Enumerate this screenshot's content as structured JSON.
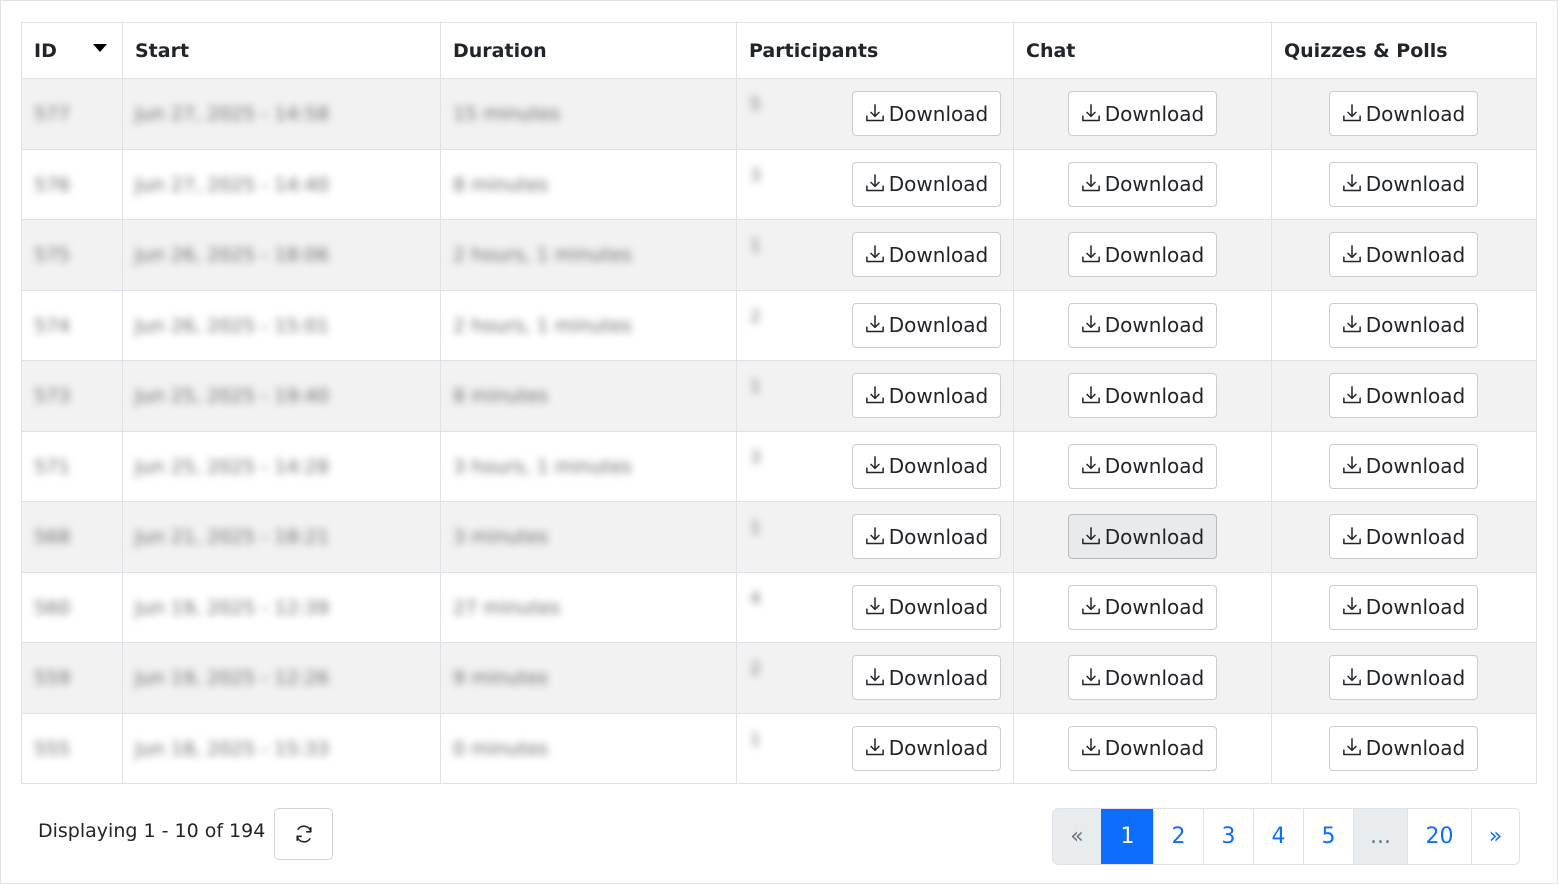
{
  "table": {
    "headers": {
      "id": "ID",
      "start": "Start",
      "duration": "Duration",
      "participants": "Participants",
      "chat": "Chat",
      "quizzes": "Quizzes & Polls"
    },
    "sort_icon": "sort-descending-caret",
    "download_icon": "download-icon",
    "rows": [
      {
        "id": "577",
        "start": "Jun 27, 2025 - 14:58",
        "duration": "15 minutes",
        "participants": "5",
        "participants_button": "Download",
        "chat_button": "Download",
        "quiz_button": "Download"
      },
      {
        "id": "576",
        "start": "Jun 27, 2025 - 14:40",
        "duration": "8 minutes",
        "participants": "3",
        "participants_button": "Download",
        "chat_button": "Download",
        "quiz_button": "Download"
      },
      {
        "id": "575",
        "start": "Jun 26, 2025 - 18:06",
        "duration": "2 hours, 1 minutes",
        "participants": "1",
        "participants_button": "Download",
        "chat_button": "Download",
        "quiz_button": "Download"
      },
      {
        "id": "574",
        "start": "Jun 26, 2025 - 15:01",
        "duration": "2 hours, 1 minutes",
        "participants": "2",
        "participants_button": "Download",
        "chat_button": "Download",
        "quiz_button": "Download"
      },
      {
        "id": "573",
        "start": "Jun 25, 2025 - 19:40",
        "duration": "8 minutes",
        "participants": "1",
        "participants_button": "Download",
        "chat_button": "Download",
        "quiz_button": "Download"
      },
      {
        "id": "571",
        "start": "Jun 25, 2025 - 14:28",
        "duration": "3 hours, 1 minutes",
        "participants": "3",
        "participants_button": "Download",
        "chat_button": "Download",
        "quiz_button": "Download"
      },
      {
        "id": "568",
        "start": "Jun 21, 2025 - 18:21",
        "duration": "3 minutes",
        "participants": "1",
        "participants_button": "Download",
        "chat_button": "Download",
        "quiz_button": "Download"
      },
      {
        "id": "560",
        "start": "Jun 19, 2025 - 12:39",
        "duration": "27 minutes",
        "participants": "4",
        "participants_button": "Download",
        "chat_button": "Download",
        "quiz_button": "Download"
      },
      {
        "id": "559",
        "start": "Jun 19, 2025 - 12:26",
        "duration": "9 minutes",
        "participants": "2",
        "participants_button": "Download",
        "chat_button": "Download",
        "quiz_button": "Download"
      },
      {
        "id": "555",
        "start": "Jun 18, 2025 - 15:33",
        "duration": "0 minutes",
        "participants": "1",
        "participants_button": "Download",
        "chat_button": "Download",
        "quiz_button": "Download"
      }
    ]
  },
  "footer": {
    "summary": "Displaying 1 - 10 of 194",
    "refresh_icon": "refresh-icon"
  },
  "pagination": {
    "prev": "«",
    "pages": [
      "1",
      "2",
      "3",
      "4",
      "5"
    ],
    "ellipsis": "...",
    "last": "20",
    "next": "»",
    "active_page": "1"
  },
  "colors": {
    "accent": "#0d6efd",
    "stripe": "#f2f2f2",
    "border": "#dee2e6"
  }
}
